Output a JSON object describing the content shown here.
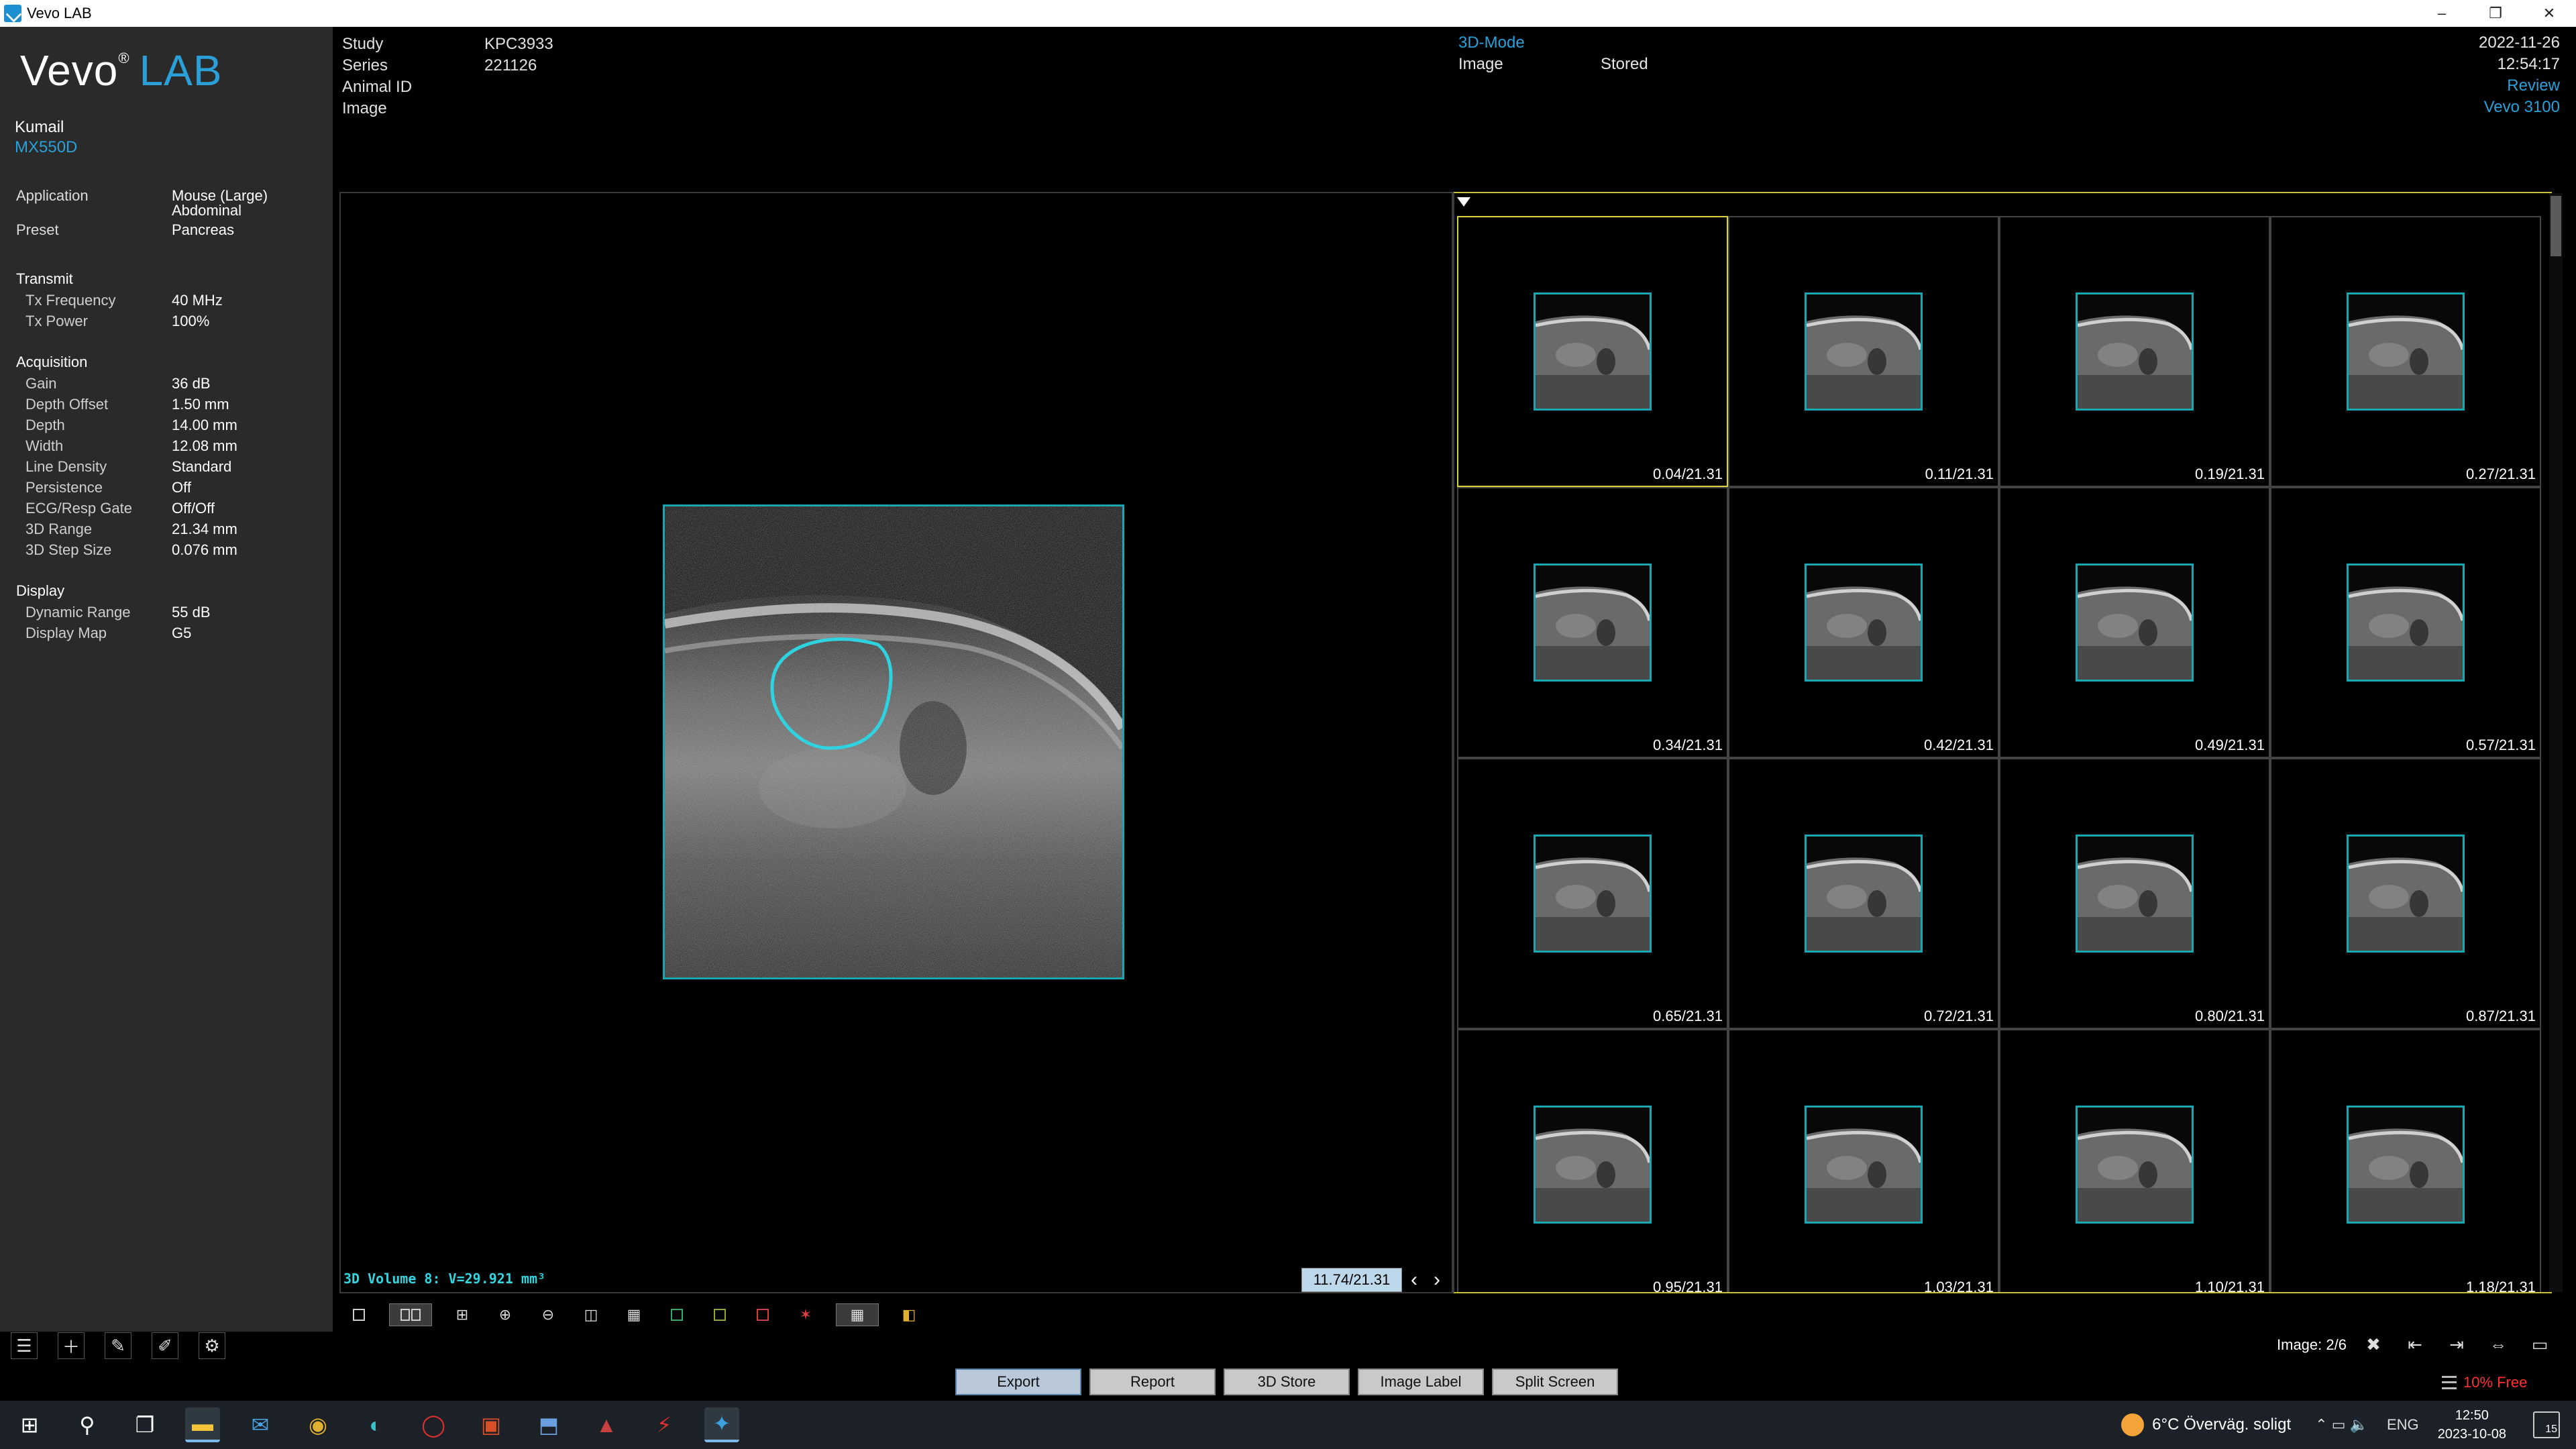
{
  "window": {
    "title": "Vevo LAB",
    "controls": [
      "–",
      "❐",
      "✕"
    ]
  },
  "logo": {
    "name": "Vevo",
    "suffix": "LAB"
  },
  "user": {
    "name": "Kumail",
    "probe": "MX550D"
  },
  "params": {
    "application_label": "Application",
    "application_value_1": "Mouse (Large)",
    "application_value_2": "Abdominal",
    "preset_label": "Preset",
    "preset_value": "Pancreas",
    "transmit_label": "Transmit",
    "tx_frequency_label": "Tx Frequency",
    "tx_frequency_value": "40 MHz",
    "tx_power_label": "Tx Power",
    "tx_power_value": "100%",
    "acquisition_label": "Acquisition",
    "acquisition_rows": [
      {
        "k": "Gain",
        "v": "36 dB"
      },
      {
        "k": "Depth Offset",
        "v": "1.50 mm"
      },
      {
        "k": "Depth",
        "v": "14.00 mm"
      },
      {
        "k": "Width",
        "v": "12.08 mm"
      },
      {
        "k": "Line Density",
        "v": "Standard"
      },
      {
        "k": "Persistence",
        "v": "Off"
      },
      {
        "k": "ECG/Resp Gate",
        "v": "Off/Off"
      },
      {
        "k": "3D Range",
        "v": "21.34 mm"
      },
      {
        "k": "3D Step Size",
        "v": "0.076 mm"
      }
    ],
    "display_label": "Display",
    "display_rows": [
      {
        "k": "Dynamic Range",
        "v": "55 dB"
      },
      {
        "k": "Display Map",
        "v": "G5"
      }
    ]
  },
  "header": {
    "study_label": "Study",
    "study_value": "KPC3933",
    "series_label": "Series",
    "series_value": "221126",
    "animal_label": "Animal ID",
    "image_label": "Image",
    "mode": "3D-Mode",
    "mode_image_label": "Image",
    "mode_image_value": "Stored",
    "date": "2022-11-26",
    "time": "12:54:17",
    "status": "Review",
    "system": "Vevo 3100"
  },
  "viewer": {
    "volume_label": "3D Volume 8: V=29.921 mm³",
    "frame_position": "11.74/21.31",
    "prev": "‹",
    "next": "›"
  },
  "thumbnails": [
    "0.04/21.31",
    "0.11/21.31",
    "0.19/21.31",
    "0.27/21.31",
    "0.34/21.31",
    "0.42/21.31",
    "0.49/21.31",
    "0.57/21.31",
    "0.65/21.31",
    "0.72/21.31",
    "0.80/21.31",
    "0.87/21.31",
    "0.95/21.31",
    "1.03/21.31",
    "1.10/21.31",
    "1.18/21.31"
  ],
  "image_count": "Image: 2/6",
  "actions": {
    "export": "Export",
    "report": "Report",
    "store3d": "3D Store",
    "image_label": "Image Label",
    "split_screen": "Split Screen"
  },
  "disk": "10% Free",
  "taskbar": {
    "weather": "6°C  Överväg. soligt",
    "lang": "ENG",
    "clock_time": "12:50",
    "clock_date": "2023-10-08",
    "notifications": "15"
  },
  "colors": {
    "accent": "#2ba0d8",
    "roi": "#1aa6b0",
    "selection": "#d8d23a",
    "warning": "#ff3030"
  }
}
